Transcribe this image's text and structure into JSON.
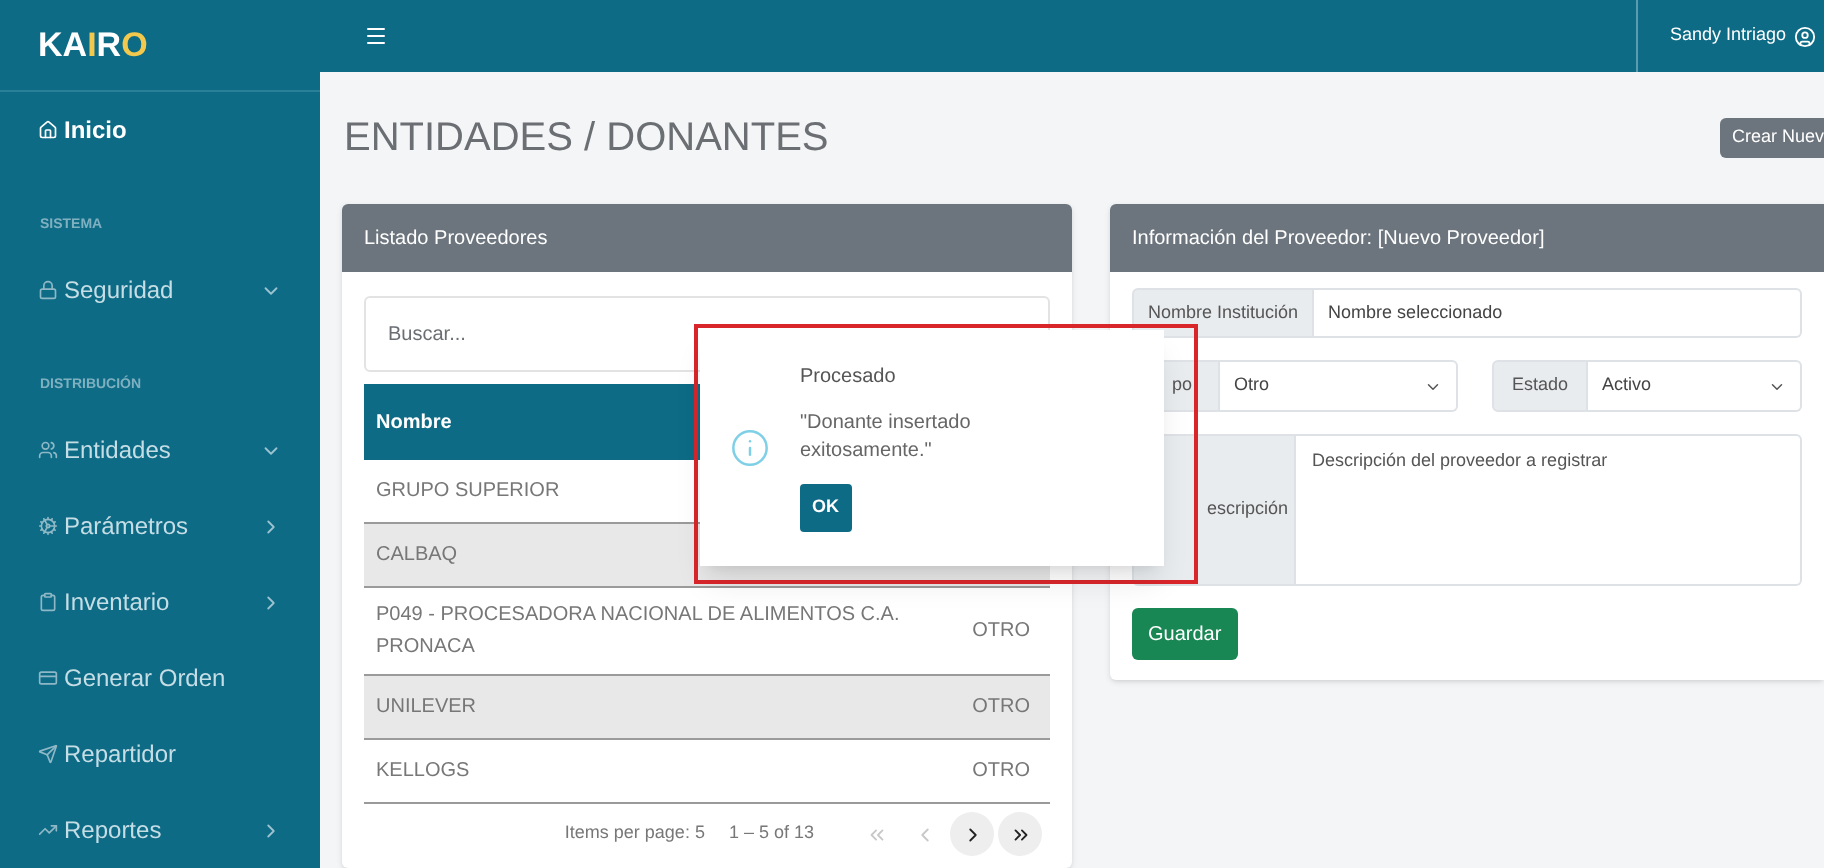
{
  "sidebar": {
    "logo": [
      {
        "text": "KA",
        "accent": false
      },
      {
        "text": "I",
        "accent": true
      },
      {
        "text": "R",
        "accent": false
      },
      {
        "text": "O",
        "accent": true
      }
    ],
    "items": [
      {
        "kind": "link",
        "label": "Inicio",
        "selected": true
      },
      {
        "kind": "section",
        "label": "SISTEMA"
      },
      {
        "kind": "link",
        "label": "Seguridad",
        "selected": false,
        "expanded": true
      },
      {
        "kind": "section",
        "label": "DISTRIBUCIÓN"
      },
      {
        "kind": "link",
        "label": "Entidades",
        "selected": false,
        "expanded": true
      },
      {
        "kind": "link",
        "label": "Parámetros",
        "selected": false,
        "expanded": false
      },
      {
        "kind": "link",
        "label": "Inventario",
        "selected": false,
        "expanded": false
      },
      {
        "kind": "link",
        "label": "Generar Orden",
        "selected": false
      },
      {
        "kind": "link",
        "label": "Repartidor",
        "selected": false
      },
      {
        "kind": "link",
        "label": "Reportes",
        "selected": false,
        "expanded": false
      }
    ]
  },
  "topbar": {
    "user": "Sandy Intriago"
  },
  "page": {
    "title": "ENTIDADES / DONANTES",
    "create_button": "Crear Nuev"
  },
  "list": {
    "title": "Listado Proveedores",
    "search": {
      "placeholder": "Buscar..."
    },
    "columns": [
      "Nombre"
    ],
    "rows": [
      {
        "name": "GRUPO SUPERIOR"
      },
      {
        "name": "CALBAQ"
      },
      {
        "name": "P049 - PROCESADORA NACIONAL DE ALIMENTOS C.A. PRONACA",
        "type": "OTRO"
      },
      {
        "name": "UNILEVER",
        "type": "OTRO"
      },
      {
        "name": "KELLOGS",
        "type": "OTRO"
      }
    ],
    "paginator": {
      "per_page": "Items per page: 5",
      "range": "1 – 5 of 13",
      "buttons": [
        {
          "disabled": true
        },
        {
          "disabled": true
        },
        {
          "disabled": false
        },
        {
          "disabled": false
        }
      ]
    }
  },
  "form": {
    "title": "Información del Proveedor: [Nuevo Proveedor]",
    "name": {
      "label": "Nombre Institución",
      "placeholder": "Nombre seleccionado"
    },
    "type": {
      "label": "po",
      "value": "Otro"
    },
    "status": {
      "label": "Estado",
      "value": "Activo"
    },
    "description": {
      "label": "escripción",
      "placeholder": "Descripción del proveedor a registrar"
    },
    "save_button": "Guardar"
  },
  "dialog": {
    "title": "Procesado",
    "message": "\"Donante insertado exitosamente.\"",
    "button": "OK"
  }
}
